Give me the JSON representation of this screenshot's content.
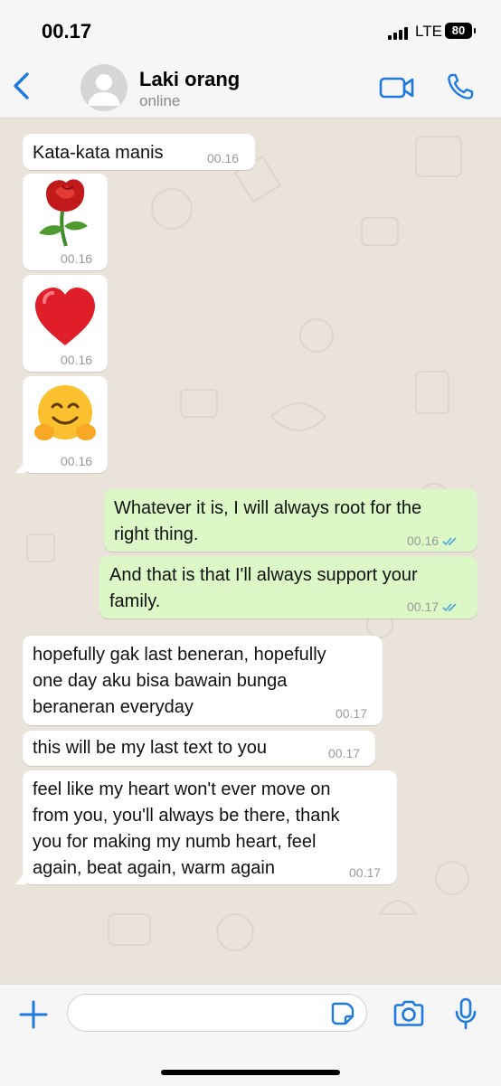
{
  "status_bar": {
    "time": "00.17",
    "network": "LTE",
    "battery": "80"
  },
  "header": {
    "contact_name": "Laki orang",
    "contact_status": "online"
  },
  "messages": [
    {
      "direction": "incoming",
      "type": "text",
      "text": "Kata-kata manis",
      "time": "00.16"
    },
    {
      "direction": "incoming",
      "type": "emoji",
      "emoji": "rose",
      "time": "00.16"
    },
    {
      "direction": "incoming",
      "type": "emoji",
      "emoji": "red-heart",
      "time": "00.16"
    },
    {
      "direction": "incoming",
      "type": "emoji",
      "emoji": "hugging-face",
      "time": "00.16"
    },
    {
      "direction": "outgoing",
      "type": "text",
      "text": "Whatever it is, I will always root for the\nright thing.",
      "time": "00.16",
      "status": "read"
    },
    {
      "direction": "outgoing",
      "type": "text",
      "text": "And that is that I'll always support your\nfamily.",
      "time": "00.17",
      "status": "read"
    },
    {
      "direction": "incoming",
      "type": "text",
      "text": "hopefully gak last beneran, hopefully\none day aku bisa bawain bunga\nberaneran everyday",
      "time": "00.17"
    },
    {
      "direction": "incoming",
      "type": "text",
      "text": "this will be my last text to you",
      "time": "00.17"
    },
    {
      "direction": "incoming",
      "type": "text",
      "text": "feel like my heart won't ever move on\nfrom you, you'll always be there, thank\nyou for making my numb heart, feel\nagain, beat again, warm again",
      "time": "00.17"
    }
  ],
  "input": {
    "placeholder": "",
    "value": ""
  },
  "colors": {
    "accent": "#1f7ae0",
    "incoming_bubble": "#ffffff",
    "outgoing_bubble": "#dcf8c6",
    "read_ticks": "#4fa3e0",
    "wallpaper": "#e9e3da"
  }
}
